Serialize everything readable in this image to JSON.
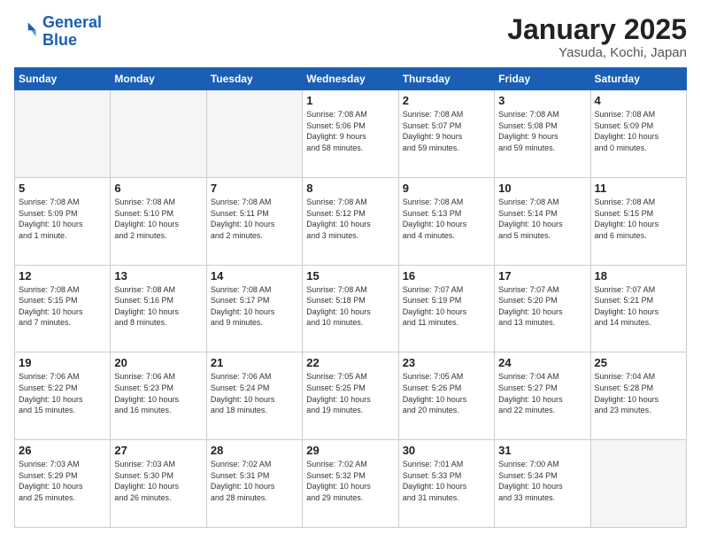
{
  "logo": {
    "line1": "General",
    "line2": "Blue"
  },
  "header": {
    "month": "January 2025",
    "location": "Yasuda, Kochi, Japan"
  },
  "weekdays": [
    "Sunday",
    "Monday",
    "Tuesday",
    "Wednesday",
    "Thursday",
    "Friday",
    "Saturday"
  ],
  "weeks": [
    [
      {
        "day": "",
        "info": ""
      },
      {
        "day": "",
        "info": ""
      },
      {
        "day": "",
        "info": ""
      },
      {
        "day": "1",
        "info": "Sunrise: 7:08 AM\nSunset: 5:06 PM\nDaylight: 9 hours\nand 58 minutes."
      },
      {
        "day": "2",
        "info": "Sunrise: 7:08 AM\nSunset: 5:07 PM\nDaylight: 9 hours\nand 59 minutes."
      },
      {
        "day": "3",
        "info": "Sunrise: 7:08 AM\nSunset: 5:08 PM\nDaylight: 9 hours\nand 59 minutes."
      },
      {
        "day": "4",
        "info": "Sunrise: 7:08 AM\nSunset: 5:09 PM\nDaylight: 10 hours\nand 0 minutes."
      }
    ],
    [
      {
        "day": "5",
        "info": "Sunrise: 7:08 AM\nSunset: 5:09 PM\nDaylight: 10 hours\nand 1 minute."
      },
      {
        "day": "6",
        "info": "Sunrise: 7:08 AM\nSunset: 5:10 PM\nDaylight: 10 hours\nand 2 minutes."
      },
      {
        "day": "7",
        "info": "Sunrise: 7:08 AM\nSunset: 5:11 PM\nDaylight: 10 hours\nand 2 minutes."
      },
      {
        "day": "8",
        "info": "Sunrise: 7:08 AM\nSunset: 5:12 PM\nDaylight: 10 hours\nand 3 minutes."
      },
      {
        "day": "9",
        "info": "Sunrise: 7:08 AM\nSunset: 5:13 PM\nDaylight: 10 hours\nand 4 minutes."
      },
      {
        "day": "10",
        "info": "Sunrise: 7:08 AM\nSunset: 5:14 PM\nDaylight: 10 hours\nand 5 minutes."
      },
      {
        "day": "11",
        "info": "Sunrise: 7:08 AM\nSunset: 5:15 PM\nDaylight: 10 hours\nand 6 minutes."
      }
    ],
    [
      {
        "day": "12",
        "info": "Sunrise: 7:08 AM\nSunset: 5:15 PM\nDaylight: 10 hours\nand 7 minutes."
      },
      {
        "day": "13",
        "info": "Sunrise: 7:08 AM\nSunset: 5:16 PM\nDaylight: 10 hours\nand 8 minutes."
      },
      {
        "day": "14",
        "info": "Sunrise: 7:08 AM\nSunset: 5:17 PM\nDaylight: 10 hours\nand 9 minutes."
      },
      {
        "day": "15",
        "info": "Sunrise: 7:08 AM\nSunset: 5:18 PM\nDaylight: 10 hours\nand 10 minutes."
      },
      {
        "day": "16",
        "info": "Sunrise: 7:07 AM\nSunset: 5:19 PM\nDaylight: 10 hours\nand 11 minutes."
      },
      {
        "day": "17",
        "info": "Sunrise: 7:07 AM\nSunset: 5:20 PM\nDaylight: 10 hours\nand 13 minutes."
      },
      {
        "day": "18",
        "info": "Sunrise: 7:07 AM\nSunset: 5:21 PM\nDaylight: 10 hours\nand 14 minutes."
      }
    ],
    [
      {
        "day": "19",
        "info": "Sunrise: 7:06 AM\nSunset: 5:22 PM\nDaylight: 10 hours\nand 15 minutes."
      },
      {
        "day": "20",
        "info": "Sunrise: 7:06 AM\nSunset: 5:23 PM\nDaylight: 10 hours\nand 16 minutes."
      },
      {
        "day": "21",
        "info": "Sunrise: 7:06 AM\nSunset: 5:24 PM\nDaylight: 10 hours\nand 18 minutes."
      },
      {
        "day": "22",
        "info": "Sunrise: 7:05 AM\nSunset: 5:25 PM\nDaylight: 10 hours\nand 19 minutes."
      },
      {
        "day": "23",
        "info": "Sunrise: 7:05 AM\nSunset: 5:26 PM\nDaylight: 10 hours\nand 20 minutes."
      },
      {
        "day": "24",
        "info": "Sunrise: 7:04 AM\nSunset: 5:27 PM\nDaylight: 10 hours\nand 22 minutes."
      },
      {
        "day": "25",
        "info": "Sunrise: 7:04 AM\nSunset: 5:28 PM\nDaylight: 10 hours\nand 23 minutes."
      }
    ],
    [
      {
        "day": "26",
        "info": "Sunrise: 7:03 AM\nSunset: 5:29 PM\nDaylight: 10 hours\nand 25 minutes."
      },
      {
        "day": "27",
        "info": "Sunrise: 7:03 AM\nSunset: 5:30 PM\nDaylight: 10 hours\nand 26 minutes."
      },
      {
        "day": "28",
        "info": "Sunrise: 7:02 AM\nSunset: 5:31 PM\nDaylight: 10 hours\nand 28 minutes."
      },
      {
        "day": "29",
        "info": "Sunrise: 7:02 AM\nSunset: 5:32 PM\nDaylight: 10 hours\nand 29 minutes."
      },
      {
        "day": "30",
        "info": "Sunrise: 7:01 AM\nSunset: 5:33 PM\nDaylight: 10 hours\nand 31 minutes."
      },
      {
        "day": "31",
        "info": "Sunrise: 7:00 AM\nSunset: 5:34 PM\nDaylight: 10 hours\nand 33 minutes."
      },
      {
        "day": "",
        "info": ""
      }
    ]
  ]
}
